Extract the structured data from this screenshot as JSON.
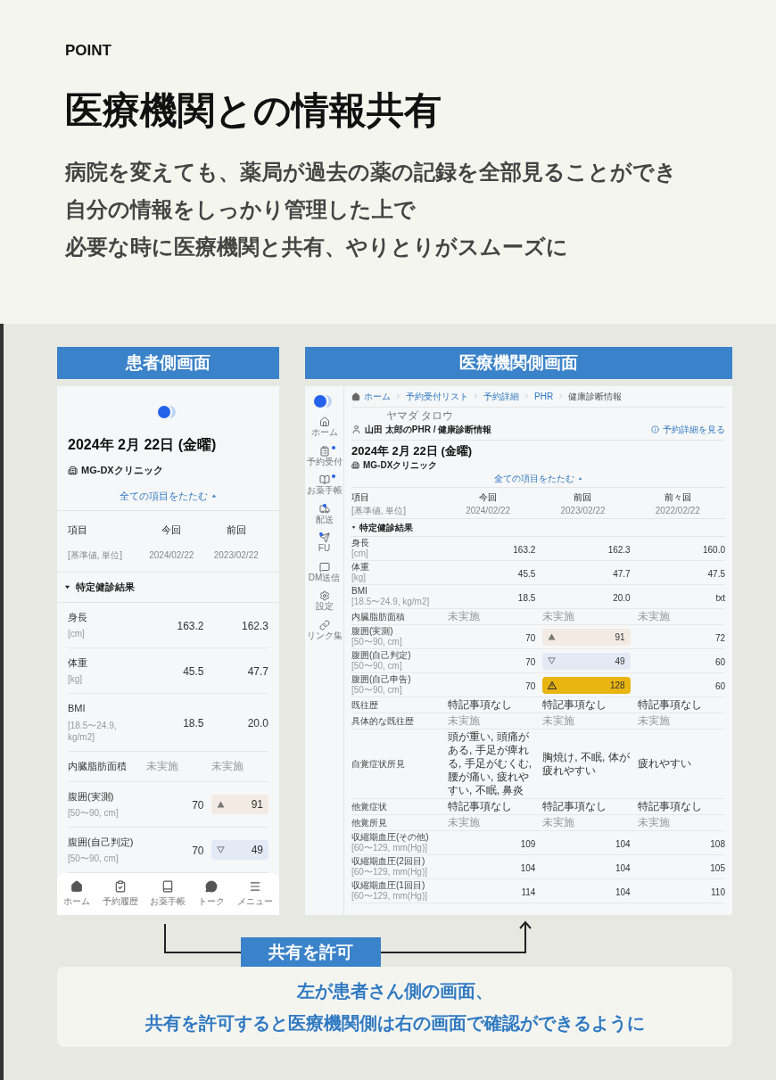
{
  "header": {
    "eyebrow": "POINT",
    "title": "医療機関との情報共有",
    "lines": [
      "病院を変えても、薬局が過去の薬の記録を全部見ることができ",
      "自分の情報をしっかり管理した上で",
      "必要な時に医療機関と共有、やりとりがスムーズに"
    ]
  },
  "patient_screen": {
    "label": "患者側画面",
    "date": "2024年 2月 22日 (金曜)",
    "clinic": "MG-DXクリニック",
    "collapse_link": "全ての項目をたたむ",
    "columns": [
      {
        "title": "項目",
        "sub": "[基準値, 単位]"
      },
      {
        "title": "今回",
        "sub": "2024/02/22"
      },
      {
        "title": "前回",
        "sub": "2023/02/22"
      }
    ],
    "section": "特定健診結果",
    "rows": [
      {
        "kind": "number",
        "label": "身長",
        "range": "[cm]",
        "values": [
          {
            "text": "163.2"
          },
          {
            "text": "162.3"
          }
        ]
      },
      {
        "kind": "number",
        "label": "体重",
        "range": "[kg]",
        "values": [
          {
            "text": "45.5"
          },
          {
            "text": "47.7"
          }
        ]
      },
      {
        "kind": "number",
        "label": "BMI",
        "range": "[18.5〜24.9, kg/m2]",
        "values": [
          {
            "text": "18.5"
          },
          {
            "text": "20.0"
          }
        ]
      },
      {
        "kind": "pending",
        "label": "内臓脂肪面積",
        "values": [
          {
            "text": "未実施"
          },
          {
            "text": "未実施"
          }
        ]
      },
      {
        "kind": "number",
        "label": "腹囲(実測)",
        "range": "[50〜90, cm]",
        "values": [
          {
            "text": "70"
          },
          {
            "text": "91",
            "kind": "up"
          }
        ]
      },
      {
        "kind": "number",
        "label": "腹囲(自己判定)",
        "range": "[50〜90, cm]",
        "values": [
          {
            "text": "70"
          },
          {
            "text": "49",
            "kind": "down"
          }
        ]
      }
    ],
    "nav": [
      {
        "label": "ホーム"
      },
      {
        "label": "予約履歴"
      },
      {
        "label": "お薬手帳"
      },
      {
        "label": "トーク"
      },
      {
        "label": "メニュー"
      }
    ]
  },
  "clinic_screen": {
    "label": "医療機関側画面",
    "sidebar": [
      {
        "label": "ホーム",
        "badge": false
      },
      {
        "label": "予約受付",
        "badge": true
      },
      {
        "label": "お薬手帳",
        "badge": true
      },
      {
        "label": "配送",
        "badge": true
      },
      {
        "label": "FU",
        "badge": true
      },
      {
        "label": "DM送信",
        "badge": false
      },
      {
        "label": "設定",
        "badge": false
      },
      {
        "label": "リンク集",
        "badge": false
      }
    ],
    "breadcrumb": [
      {
        "label": "ホーム",
        "selected": false
      },
      {
        "label": "予約受付リスト",
        "selected": false
      },
      {
        "label": "予約詳細",
        "selected": false
      },
      {
        "label": "PHR",
        "selected": false
      },
      {
        "label": "健康診断情報",
        "selected": true
      }
    ],
    "patient_kana": "ヤマダ タロウ",
    "patient_title": "山田 太郎のPHR / 健康診断情報",
    "details_link": "予約詳細を見る",
    "date": "2024年 2月 22日 (金曜)",
    "clinic": "MG-DXクリニック",
    "collapse_link": "全ての項目をたたむ",
    "columns": [
      {
        "title": "項目",
        "sub": "[基準値, 単位]"
      },
      {
        "title": "今回",
        "sub": "2024/02/22"
      },
      {
        "title": "前回",
        "sub": "2023/02/22"
      },
      {
        "title": "前々回",
        "sub": "2022/02/22"
      }
    ],
    "section": "特定健診結果",
    "rows": [
      {
        "kind": "number",
        "label": "身長",
        "range": "[cm]",
        "values": [
          {
            "text": "163.2"
          },
          {
            "text": "162.3"
          },
          {
            "text": "160.0"
          }
        ]
      },
      {
        "kind": "number",
        "label": "体重",
        "range": "[kg]",
        "values": [
          {
            "text": "45.5"
          },
          {
            "text": "47.7"
          },
          {
            "text": "47.5"
          }
        ]
      },
      {
        "kind": "number",
        "label": "BMI",
        "range": "[18.5〜24.9, kg/m2]",
        "values": [
          {
            "text": "18.5"
          },
          {
            "text": "20.0"
          },
          {
            "text": "txt"
          }
        ]
      },
      {
        "kind": "pending",
        "label": "内臓脂肪面積",
        "values": [
          {
            "text": "未実施"
          },
          {
            "text": "未実施"
          },
          {
            "text": "未実施"
          }
        ]
      },
      {
        "kind": "number",
        "label": "腹囲(実測)",
        "range": "[50〜90, cm]",
        "values": [
          {
            "text": "70"
          },
          {
            "text": "91",
            "kind": "up"
          },
          {
            "text": "72"
          }
        ]
      },
      {
        "kind": "number",
        "label": "腹囲(自己判定)",
        "range": "[50〜90, cm]",
        "values": [
          {
            "text": "70"
          },
          {
            "text": "49",
            "kind": "down"
          },
          {
            "text": "60"
          }
        ]
      },
      {
        "kind": "number",
        "label": "腹囲(自己申告)",
        "range": "[50〜90, cm]",
        "values": [
          {
            "text": "70"
          },
          {
            "text": "128",
            "kind": "alert"
          },
          {
            "text": "60"
          }
        ]
      },
      {
        "kind": "text",
        "label": "既往歴",
        "values": [
          {
            "text": "特記事項なし"
          },
          {
            "text": "特記事項なし"
          },
          {
            "text": "特記事項なし"
          }
        ]
      },
      {
        "kind": "pending",
        "label": "具体的な既往歴",
        "values": [
          {
            "text": "未実施"
          },
          {
            "text": "未実施"
          },
          {
            "text": "未実施"
          }
        ]
      },
      {
        "kind": "text",
        "label": "自覚症状所見",
        "values": [
          {
            "text": "頭が重い, 頭痛がある, 手足が痺れる, 手足がむくむ,腰が痛い, 疲れやすい, 不眠, 鼻炎"
          },
          {
            "text": "胸焼け, 不眠, 体が疲れやすい"
          },
          {
            "text": "疲れやすい"
          }
        ]
      },
      {
        "kind": "text",
        "label": "他覚症状",
        "values": [
          {
            "text": "特記事項なし"
          },
          {
            "text": "特記事項なし"
          },
          {
            "text": "特記事項なし"
          }
        ]
      },
      {
        "kind": "pending",
        "label": "他覚所見",
        "values": [
          {
            "text": "未実施"
          },
          {
            "text": "未実施"
          },
          {
            "text": "未実施"
          }
        ]
      },
      {
        "kind": "number",
        "label": "収縮期血圧(その他)",
        "range": "[60〜129, mm(Hg)]",
        "values": [
          {
            "text": "109"
          },
          {
            "text": "104"
          },
          {
            "text": "108"
          }
        ]
      },
      {
        "kind": "number",
        "label": "収縮期血圧(2回目)",
        "range": "[60〜129, mm(Hg)]",
        "values": [
          {
            "text": "104"
          },
          {
            "text": "104"
          },
          {
            "text": "105"
          }
        ]
      },
      {
        "kind": "number",
        "label": "収縮期血圧(1回目)",
        "range": "[60〜129, mm(Hg)]",
        "values": [
          {
            "text": "114"
          },
          {
            "text": "104"
          },
          {
            "text": "110"
          }
        ]
      }
    ]
  },
  "share_label": "共有を許可",
  "caption": [
    "左が患者さん側の画面、",
    "共有を許可すると医療機関側は右の画面で確認ができるように"
  ]
}
